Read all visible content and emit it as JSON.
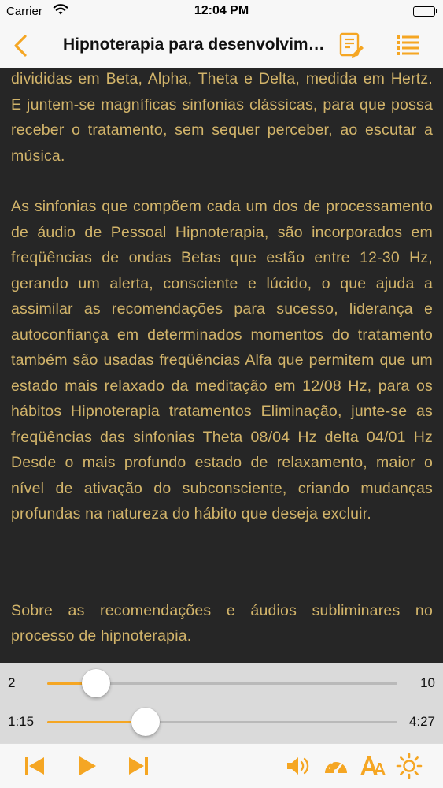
{
  "status_bar": {
    "carrier": "Carrier",
    "time": "12:04 PM"
  },
  "nav": {
    "title": "Hipnoterapia para desenvolvimento pessoal"
  },
  "content": {
    "paragraphs": [
      "divididas em Beta, Alpha, Theta e Delta, medida em Hertz. E juntem-se magníficas sinfonias clássicas, para que possa receber o tratamento, sem sequer perceber, ao escutar a música.",
      "As sinfonias que compõem cada um dos de processamento de áudio de Pessoal Hipnoterapia, são incorporados em freqüências de ondas Betas que estão entre 12-30 Hz, gerando um alerta, consciente e lúcido, o que ajuda a assimilar as recomendações para sucesso, liderança e autoconfiança em determinados momentos do tratamento também são usadas freqüências Alfa que permitem que um estado mais relaxado da meditação em 12/08 Hz, para os hábitos Hipnoterapia tratamentos Eliminação, junte-se as freqüências das sinfonias Theta 08/04 Hz delta 04/01 Hz Desde o mais profundo estado de relaxamento, maior o nível de ativação do subconsciente, criando mudanças profundas na natureza do hábito que deseja excluir.",
      "Sobre as recomendações e áudios subliminares no processo de hipnoterapia."
    ]
  },
  "speed_slider": {
    "min_label": "2",
    "max_label": "10",
    "value_fraction": 0.14
  },
  "progress_slider": {
    "elapsed": "1:15",
    "total": "4:27",
    "value_fraction": 0.28
  },
  "colors": {
    "accent": "#f5a623",
    "text": "#d2b46a",
    "reader_background": "#262626"
  },
  "icons": {
    "back": "chevron-left-icon",
    "notes": "notes-edit-icon",
    "list": "list-icon",
    "previous": "skip-previous-icon",
    "play": "play-icon",
    "next": "skip-next-icon",
    "volume": "volume-icon",
    "speed": "speedometer-icon",
    "font_size": "font-size-icon",
    "brightness": "brightness-icon"
  }
}
